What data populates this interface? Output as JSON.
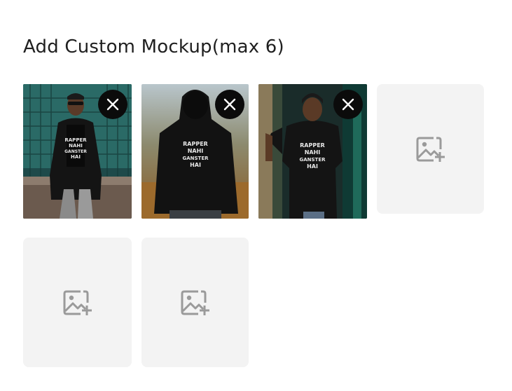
{
  "title": "Add Custom Mockup(max 6)",
  "mockups": [
    {
      "kind": "photo",
      "subject": "man in leather jacket with black t-shirt",
      "shirt_text": [
        "RAPPER",
        "NAHI",
        "GANSTER",
        "HAI"
      ],
      "remove_icon": "close-icon"
    },
    {
      "kind": "photo",
      "subject": "back of person in black hoodie",
      "shirt_text": [
        "RAPPER",
        "NAHI",
        "GANSTER",
        "HAI"
      ],
      "remove_icon": "close-icon"
    },
    {
      "kind": "photo",
      "subject": "smiling man in black t-shirt",
      "shirt_text": [
        "RAPPER",
        "NAHI",
        "GANSTER",
        "HAI"
      ],
      "remove_icon": "close-icon"
    },
    {
      "kind": "empty",
      "icon": "add-image-icon"
    },
    {
      "kind": "empty",
      "icon": "add-image-icon"
    },
    {
      "kind": "empty",
      "icon": "add-image-icon"
    }
  ],
  "colors": {
    "empty_tile": "#f3f3f3",
    "icon_gray": "#9a9a9a",
    "remove_button": "#0b0b0b"
  }
}
